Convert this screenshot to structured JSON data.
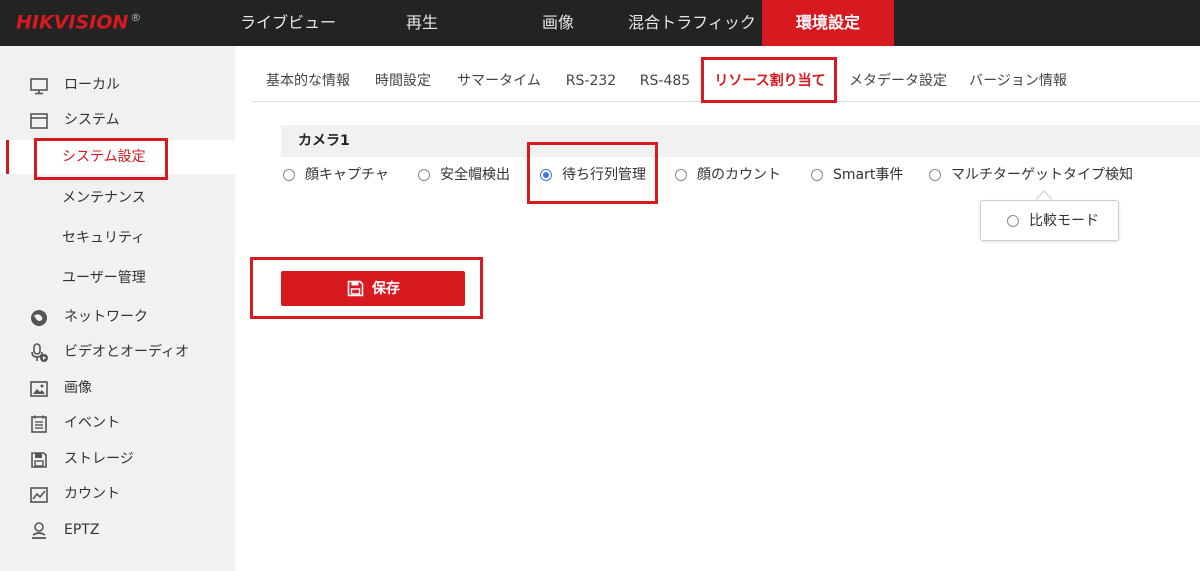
{
  "brand": {
    "logo": "HIKVISION",
    "reg": "®"
  },
  "topnav": [
    {
      "label": "ライブビュー"
    },
    {
      "label": "再生"
    },
    {
      "label": "画像"
    },
    {
      "label": "混合トラフィック"
    },
    {
      "label": "環境設定",
      "active": true
    }
  ],
  "sidebar": {
    "items": [
      {
        "label": "ローカル",
        "icon": "monitor-icon"
      },
      {
        "label": "システム",
        "icon": "system-window-icon"
      },
      {
        "label": "システム設定",
        "sub": true,
        "active": true
      },
      {
        "label": "メンテナンス",
        "sub": true
      },
      {
        "label": "セキュリティ",
        "sub": true
      },
      {
        "label": "ユーザー管理",
        "sub": true
      },
      {
        "label": "ネットワーク",
        "icon": "globe-icon"
      },
      {
        "label": "ビデオとオーディオ",
        "icon": "microphone-icon"
      },
      {
        "label": "画像",
        "icon": "image-icon"
      },
      {
        "label": "イベント",
        "icon": "event-list-icon"
      },
      {
        "label": "ストレージ",
        "icon": "storage-icon"
      },
      {
        "label": "カウント",
        "icon": "count-chart-icon"
      },
      {
        "label": "EPTZ",
        "icon": "person-icon"
      }
    ]
  },
  "tabs": [
    {
      "label": "基本的な情報"
    },
    {
      "label": "時間設定"
    },
    {
      "label": "サマータイム"
    },
    {
      "label": "RS-232"
    },
    {
      "label": "RS-485"
    },
    {
      "label": "リソース割り当て",
      "active": true
    },
    {
      "label": "メタデータ設定"
    },
    {
      "label": "バージョン情報"
    }
  ],
  "content": {
    "section_title": "カメラ1",
    "options": [
      {
        "label": "顔キャプチャ",
        "selected": false
      },
      {
        "label": "安全帽検出",
        "selected": false
      },
      {
        "label": "待ち行列管理",
        "selected": true
      },
      {
        "label": "顔のカウント",
        "selected": false
      },
      {
        "label": "Smart事件",
        "selected": false
      },
      {
        "label": "マルチターゲットタイプ検知",
        "selected": false
      }
    ],
    "popup_option": {
      "label": "比較モード",
      "selected": false
    },
    "save_label": "保存"
  },
  "colors": {
    "accent": "#d71920",
    "topbar": "#232323",
    "sidebar": "#f1f1f1",
    "radio_selected": "#3a7bd5"
  }
}
